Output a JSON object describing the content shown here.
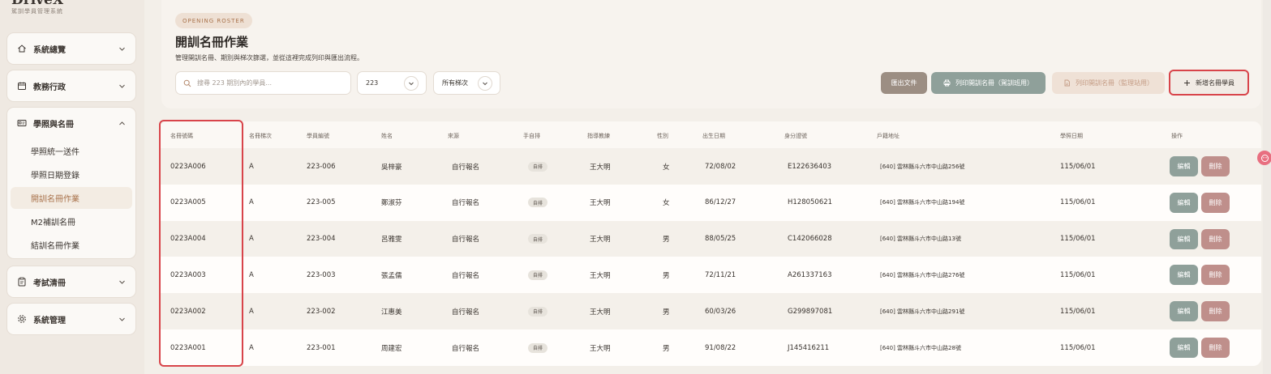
{
  "brand": {
    "name": "DriveX",
    "subtitle": "駕訓學員管理系統"
  },
  "sidebar": {
    "sections": [
      {
        "label": "系統總覽",
        "icon": "home-icon"
      },
      {
        "label": "教務行政",
        "icon": "calendar-icon"
      },
      {
        "label": "學照與名冊",
        "icon": "id-card-icon",
        "expanded": true,
        "items": [
          {
            "label": "學照統一送件"
          },
          {
            "label": "學照日期登錄"
          },
          {
            "label": "開訓名冊作業",
            "active": true
          },
          {
            "label": "M2補訓名冊"
          },
          {
            "label": "結訓名冊作業"
          }
        ]
      },
      {
        "label": "考試清冊",
        "icon": "clipboard-icon"
      },
      {
        "label": "系統管理",
        "icon": "gear-icon"
      }
    ]
  },
  "header": {
    "eyebrow": "OPENING ROSTER",
    "title": "開訓名冊作業",
    "description": "管理開訓名冊、期別與梯次篩選，並從這裡完成列印與匯出流程。",
    "search_placeholder": "搜尋 223 期別內的學員...",
    "period_select": "223",
    "batch_select": "所有梯次"
  },
  "toolbar": {
    "export_label": "匯出文件",
    "print_class_label": "列印開訓名冊（駕訓班用）",
    "print_supervision_label": "列印開訓名冊（監理站用）",
    "add_label": "新增名冊學員"
  },
  "table": {
    "headers": [
      "名冊號碼",
      "名冊梯次",
      "學員編號",
      "姓名",
      "來源",
      "手自排",
      "指導教練",
      "性別",
      "出生日期",
      "身分證號",
      "戶籍地址",
      "學照日期",
      "操作"
    ],
    "rows": [
      {
        "roster_no": "0223A006",
        "batch": "A",
        "student_no": "223-006",
        "name": "吳梓豪",
        "source": "自行報名",
        "trans": "自排",
        "coach": "王大明",
        "gender": "女",
        "birth": "72/08/02",
        "id_no": "E122636403",
        "address": "[640] 雲林縣斗六市中山路256號",
        "license_date": "115/06/01"
      },
      {
        "roster_no": "0223A005",
        "batch": "A",
        "student_no": "223-005",
        "name": "鄭淑芬",
        "source": "自行報名",
        "trans": "自排",
        "coach": "王大明",
        "gender": "女",
        "birth": "86/12/27",
        "id_no": "H128050621",
        "address": "[640] 雲林縣斗六市中山路194號",
        "license_date": "115/06/01"
      },
      {
        "roster_no": "0223A004",
        "batch": "A",
        "student_no": "223-004",
        "name": "呂雅雯",
        "source": "自行報名",
        "trans": "自排",
        "coach": "王大明",
        "gender": "男",
        "birth": "88/05/25",
        "id_no": "C142066028",
        "address": "[640] 雲林縣斗六市中山路13號",
        "license_date": "115/06/01"
      },
      {
        "roster_no": "0223A003",
        "batch": "A",
        "student_no": "223-003",
        "name": "張孟儒",
        "source": "自行報名",
        "trans": "自排",
        "coach": "王大明",
        "gender": "男",
        "birth": "72/11/21",
        "id_no": "A261337163",
        "address": "[640] 雲林縣斗六市中山路276號",
        "license_date": "115/06/01"
      },
      {
        "roster_no": "0223A002",
        "batch": "A",
        "student_no": "223-002",
        "name": "江惠美",
        "source": "自行報名",
        "trans": "自排",
        "coach": "王大明",
        "gender": "男",
        "birth": "60/03/26",
        "id_no": "G299897081",
        "address": "[640] 雲林縣斗六市中山路291號",
        "license_date": "115/06/01"
      },
      {
        "roster_no": "0223A001",
        "batch": "A",
        "student_no": "223-001",
        "name": "周建宏",
        "source": "自行報名",
        "trans": "自排",
        "coach": "王大明",
        "gender": "男",
        "birth": "91/08/22",
        "id_no": "J145416211",
        "address": "[640] 雲林縣斗六市中山路28號",
        "license_date": "115/06/01"
      }
    ],
    "edit_label": "編輯",
    "delete_label": "刪除"
  },
  "colors": {
    "accent": "#a9734c",
    "sage": "#8fa09a",
    "rose": "#bf8f8b",
    "highlight": "#d8444a"
  }
}
